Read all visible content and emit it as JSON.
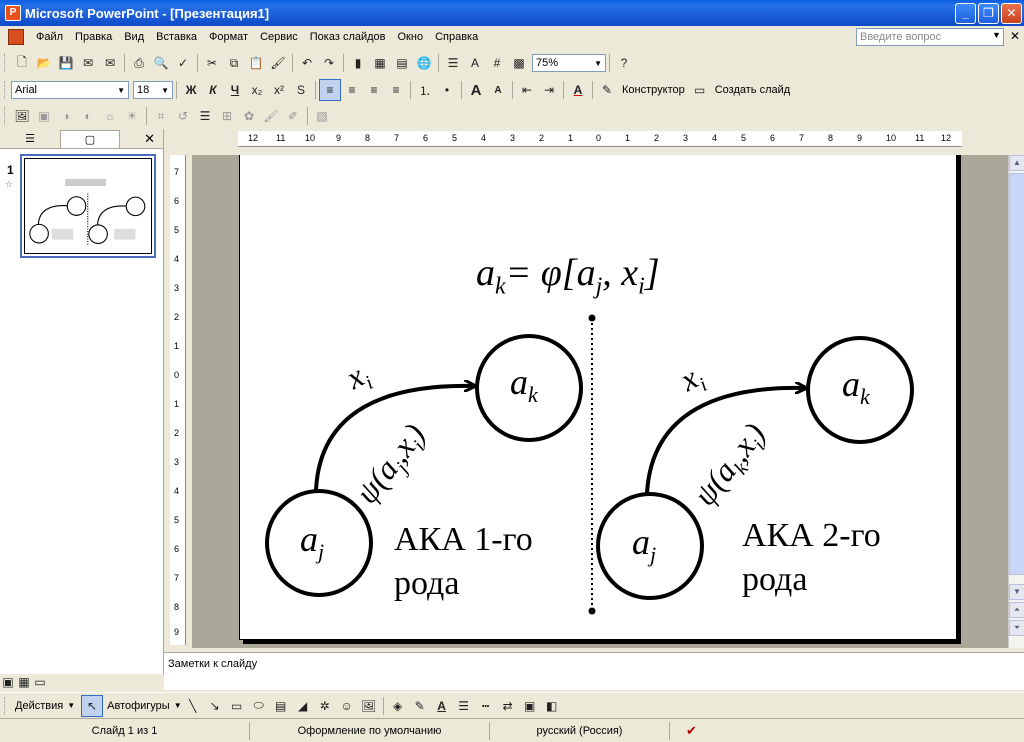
{
  "window": {
    "title": "Microsoft PowerPoint - [Презентация1]",
    "min": "_",
    "max": "❐",
    "close": "✕"
  },
  "menu": {
    "items": [
      "Файл",
      "Правка",
      "Вид",
      "Вставка",
      "Формат",
      "Сервис",
      "Показ слайдов",
      "Окно",
      "Справка"
    ],
    "help_placeholder": "Введите вопрос"
  },
  "standard_toolbar": {
    "zoom": "75%"
  },
  "formatting_toolbar": {
    "font": "Arial",
    "size": "18",
    "bold": "Ж",
    "italic": "К",
    "underline": "Ч",
    "designer": "Конструктор",
    "new_slide": "Создать слайд"
  },
  "slides_pane": {
    "slide_number": "1"
  },
  "ruler": {
    "h_labels": [
      "12",
      "11",
      "10",
      "9",
      "8",
      "7",
      "6",
      "5",
      "4",
      "3",
      "2",
      "1",
      "0",
      "1",
      "2",
      "3",
      "4",
      "5",
      "6",
      "7",
      "8",
      "9",
      "10",
      "11",
      "12"
    ],
    "v_labels": [
      "7",
      "6",
      "5",
      "4",
      "3",
      "2",
      "1",
      "0",
      "1",
      "2",
      "3",
      "4",
      "5",
      "6",
      "7",
      "8",
      "9"
    ]
  },
  "slide": {
    "formula": {
      "a": "a",
      "k": "k",
      "eq": "= φ[a",
      "j": "j",
      "comma": ", x",
      "i": "i",
      "close": "]"
    },
    "left_diagram": {
      "start_state": "a",
      "start_sub": "j",
      "end_state": "a",
      "end_sub": "k",
      "input": "x",
      "input_sub": "i",
      "output_fn": "ψ(a",
      "output_sub1": "j",
      "output_mid": ",x",
      "output_sub2": "i",
      "output_close": ")",
      "caption_line1": "АКА 1-го",
      "caption_line2": "рода"
    },
    "right_diagram": {
      "start_state": "a",
      "start_sub": "j",
      "end_state": "a",
      "end_sub": "k",
      "input": "x",
      "input_sub": "i",
      "output_fn": "ψ(a",
      "output_sub1": "k",
      "output_mid": ",x",
      "output_sub2": "i",
      "output_close": ")",
      "caption_line1": "АКА 2-го",
      "caption_line2": "рода"
    }
  },
  "notes": {
    "placeholder": "Заметки к слайду"
  },
  "drawing_toolbar": {
    "actions": "Действия",
    "autoshapes": "Автофигуры"
  },
  "status": {
    "slide": "Слайд 1 из 1",
    "design": "Оформление по умолчанию",
    "language": "русский (Россия)"
  }
}
